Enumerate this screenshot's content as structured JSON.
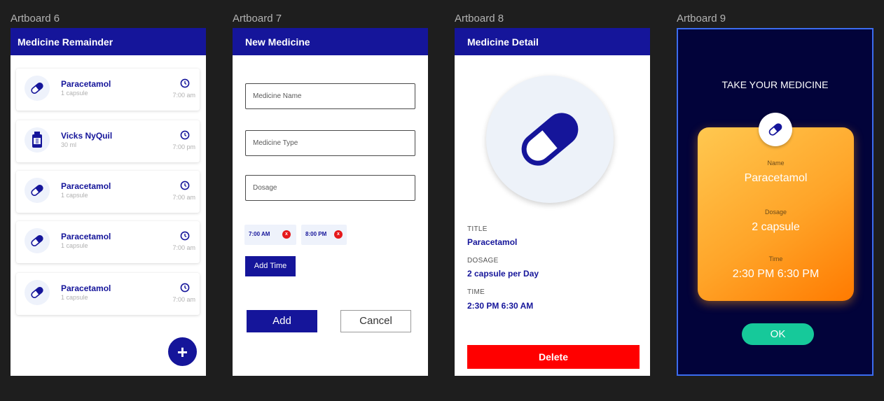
{
  "artboard_labels": [
    "Artboard 6",
    "Artboard 7",
    "Artboard 8",
    "Artboard 9"
  ],
  "reminder": {
    "title": "Medicine Remainder",
    "items": [
      {
        "name": "Paracetamol",
        "sub": "1 capsule",
        "time": "7:00 am",
        "icon": "pill-icon"
      },
      {
        "name": "Vicks NyQuil",
        "sub": "30 ml",
        "time": "7:00 pm",
        "icon": "bottle-icon"
      },
      {
        "name": "Paracetamol",
        "sub": "1 capsule",
        "time": "7:00 am",
        "icon": "pill-icon"
      },
      {
        "name": "Paracetamol",
        "sub": "1 capsule",
        "time": "7:00 am",
        "icon": "pill-icon"
      },
      {
        "name": "Paracetamol",
        "sub": "1 capsule",
        "time": "7:00 am",
        "icon": "pill-icon"
      }
    ],
    "fab": "+"
  },
  "new_medicine": {
    "title": "New Medicine",
    "name_placeholder": "Medicine Name",
    "type_placeholder": "Medicine Type",
    "dosage_placeholder": "Dosage",
    "times": [
      {
        "label": "7:00 AM",
        "remove": "x"
      },
      {
        "label": "8:00 PM",
        "remove": "x"
      }
    ],
    "add_time": "Add Time",
    "add": "Add",
    "cancel": "Cancel"
  },
  "detail": {
    "title": "Medicine Detail",
    "title_label": "TITLE",
    "title_value": "Paracetamol",
    "dosage_label": "DOSAGE",
    "dosage_value": "2 capsule per Day",
    "time_label": "TIME",
    "time_value": "2:30 PM 6:30 AM",
    "delete": "Delete"
  },
  "alert": {
    "heading": "TAKE YOUR MEDICINE",
    "name_label": "Name",
    "name_value": "Paracetamol",
    "dosage_label": "Dosage",
    "dosage_value": "2 capsule",
    "time_label": "Time",
    "time_value": "2:30 PM 6:30 PM",
    "ok": "OK"
  },
  "colors": {
    "primary": "#15159a",
    "danger": "#ff0000",
    "accent": "#16c99a",
    "orange": "#ffa428",
    "dark_bg": "#02033a"
  }
}
